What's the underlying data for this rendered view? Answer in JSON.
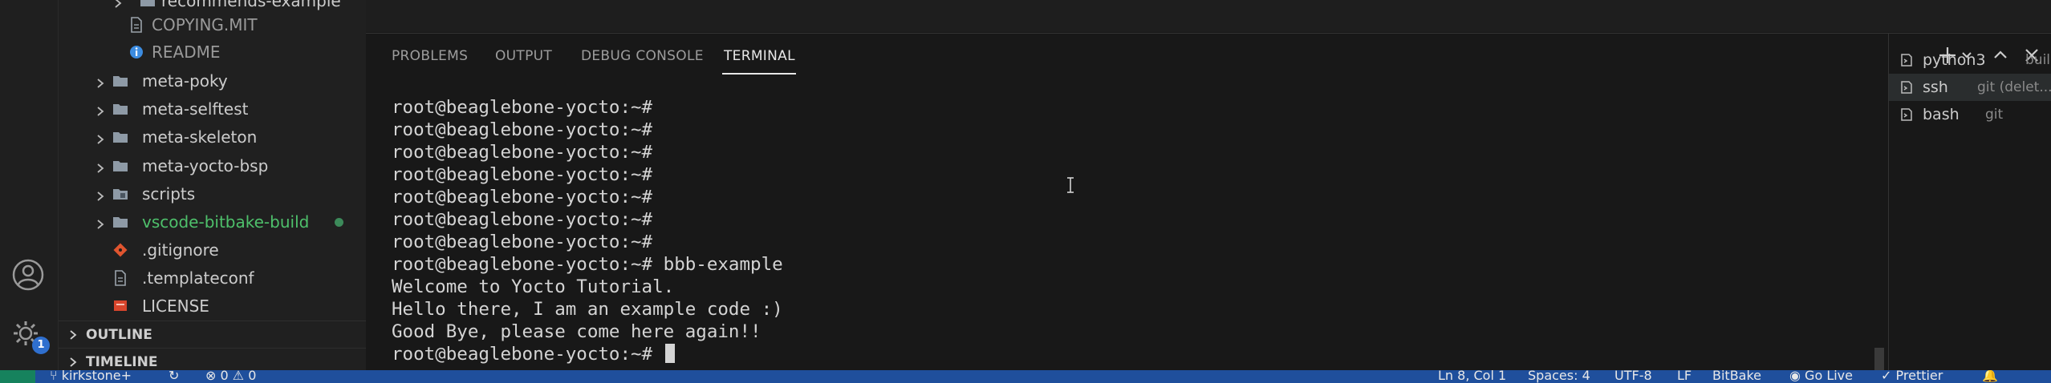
{
  "explorer": {
    "items": [
      {
        "label": "recommends-example",
        "type": "folder",
        "chevron": true,
        "indent": 1
      },
      {
        "label": "COPYING.MIT",
        "type": "file",
        "chevron": false,
        "indent": 2
      },
      {
        "label": "README",
        "type": "info",
        "chevron": false,
        "indent": 2
      },
      {
        "label": "meta-poky",
        "type": "folder",
        "chevron": true,
        "indent": 0
      },
      {
        "label": "meta-selftest",
        "type": "folder",
        "chevron": true,
        "indent": 0
      },
      {
        "label": "meta-skeleton",
        "type": "folder",
        "chevron": true,
        "indent": 0
      },
      {
        "label": "meta-yocto-bsp",
        "type": "folder",
        "chevron": true,
        "indent": 0
      },
      {
        "label": "scripts",
        "type": "folder-special",
        "chevron": true,
        "indent": 0
      },
      {
        "label": "vscode-bitbake-build",
        "type": "folder",
        "chevron": true,
        "indent": 0,
        "modified": true
      },
      {
        "label": ".gitignore",
        "type": "git",
        "chevron": false,
        "indent": 0
      },
      {
        "label": ".templateconf",
        "type": "file",
        "chevron": false,
        "indent": 0
      },
      {
        "label": "LICENSE",
        "type": "license",
        "chevron": false,
        "indent": 0
      }
    ],
    "sections": {
      "outline": "OUTLINE",
      "timeline": "TIMELINE"
    }
  },
  "activity": {
    "accounts_icon": "account-icon",
    "settings_icon": "gear-icon",
    "settings_badge": "1"
  },
  "panel": {
    "tabs": [
      "PROBLEMS",
      "OUTPUT",
      "DEBUG CONSOLE",
      "TERMINAL"
    ],
    "active_tab": "TERMINAL"
  },
  "terminal": {
    "lines": [
      "root@beaglebone-yocto:~#",
      "root@beaglebone-yocto:~#",
      "root@beaglebone-yocto:~#",
      "root@beaglebone-yocto:~#",
      "root@beaglebone-yocto:~#",
      "root@beaglebone-yocto:~#",
      "root@beaglebone-yocto:~#",
      "root@beaglebone-yocto:~# bbb-example",
      "Welcome to Yocto Tutorial.",
      "Hello there, I am an example code :)",
      "Good Bye, please come here again!!",
      "root@beaglebone-yocto:~# "
    ]
  },
  "terminal_list": [
    {
      "name": "python3",
      "desc": "build",
      "selected": false
    },
    {
      "name": "ssh",
      "desc": "git (delet...",
      "selected": true
    },
    {
      "name": "bash",
      "desc": "git",
      "selected": false
    }
  ],
  "status": {
    "branch": "kirkstone+",
    "problems": "0",
    "warnings": "0",
    "position": "Ln 8, Col 1",
    "spaces": "Spaces: 4",
    "encoding": "UTF-8",
    "eol": "LF",
    "language": "BitBake",
    "golive": "Go Live",
    "prettier": "Prettier"
  },
  "colors": {
    "accent": "#1f4f9c",
    "remote": "#16825d",
    "modified": "#3c8a5a",
    "folder_green": "#4ec06b"
  }
}
